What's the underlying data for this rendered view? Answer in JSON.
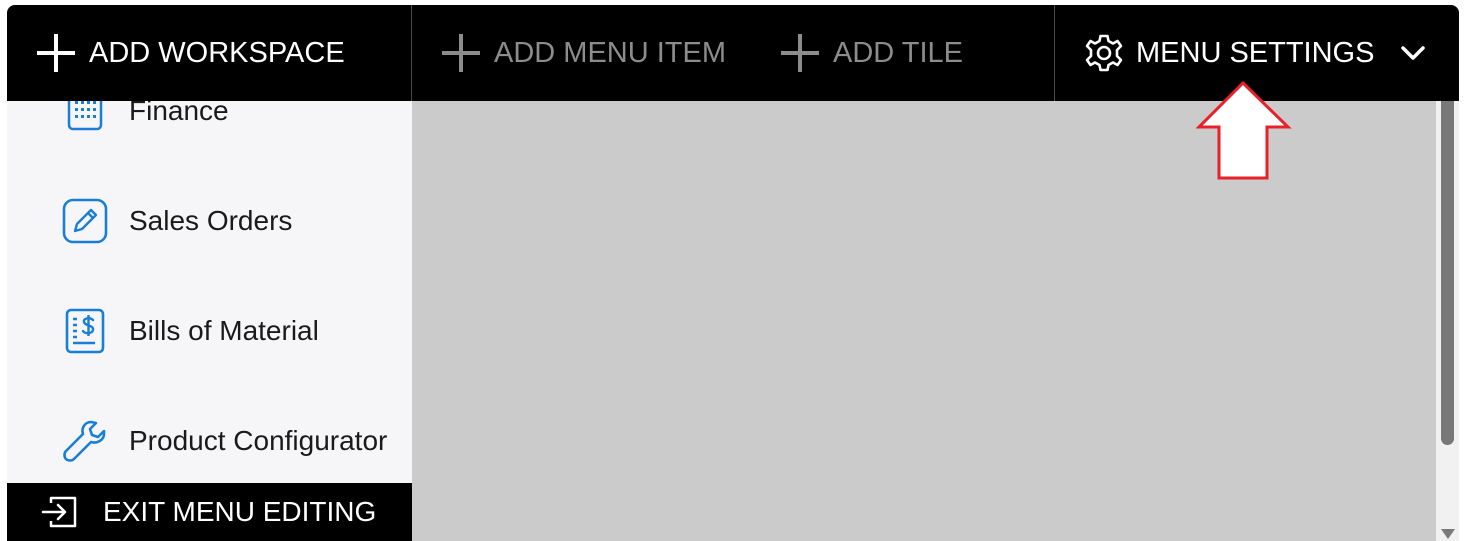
{
  "toolbar": {
    "add_workspace": "ADD WORKSPACE",
    "add_menu_item": "ADD MENU ITEM",
    "add_tile": "ADD TILE",
    "menu_settings": "MENU SETTINGS"
  },
  "sidebar": {
    "items": [
      {
        "label": "Finance",
        "icon": "calculator-icon"
      },
      {
        "label": "Sales Orders",
        "icon": "edit-pencil-icon"
      },
      {
        "label": "Bills of Material",
        "icon": "invoice-dollar-icon"
      },
      {
        "label": "Product Configurator",
        "icon": "wrench-icon"
      }
    ],
    "exit_label": "EXIT MENU EDITING"
  },
  "colors": {
    "toolbar_bg": "#000000",
    "sidebar_bg": "#f6f6f8",
    "content_bg": "#cbcbcb",
    "icon_blue": "#1a7fd4",
    "disabled_text": "#8c8c8c",
    "callout_red": "#e8202a"
  }
}
